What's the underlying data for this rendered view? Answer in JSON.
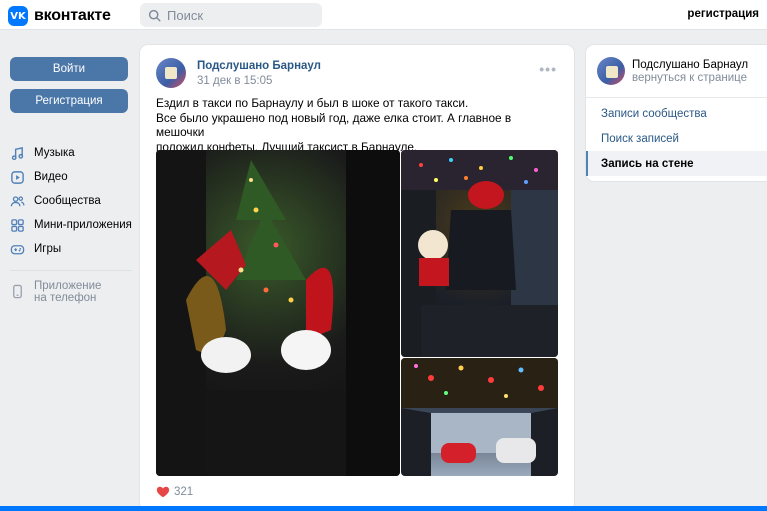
{
  "header": {
    "logo_mark": "VK",
    "logo_text": "вконтакте",
    "search_placeholder": "Поиск",
    "register_link": "регистрация"
  },
  "sidebar": {
    "login_button": "Войти",
    "register_button": "Регистрация",
    "items": [
      {
        "label": "Музыка",
        "icon": "music-icon"
      },
      {
        "label": "Видео",
        "icon": "video-icon"
      },
      {
        "label": "Сообщества",
        "icon": "communities-icon"
      },
      {
        "label": "Мини-приложения",
        "icon": "mini-apps-icon"
      },
      {
        "label": "Игры",
        "icon": "games-icon"
      }
    ],
    "app_line1": "Приложение",
    "app_line2": "на телефон"
  },
  "post": {
    "author": "Подслушано Барнаул",
    "date": "31 дек в 15:05",
    "more": "•••",
    "text_lines": [
      "Ездил в такси по Барнаулу и был в шоке от такого такси.",
      "Все было украшено под новый год, даже елка стоит. А главное в мешочки",
      "положил конфеты. Лучший таксист в Барнауле."
    ],
    "likes": "321"
  },
  "right_panel": {
    "name": "Подслушано Барнаул",
    "back": "вернуться к странице",
    "items": [
      {
        "label": "Записи сообщества"
      },
      {
        "label": "Поиск записей"
      },
      {
        "label": "Запись на стене"
      }
    ]
  },
  "colors": {
    "accent": "#0077ff",
    "button": "#4a76a8",
    "link": "#2a5885",
    "secondary_text": "#818c99",
    "like_heart": "#e64646"
  }
}
